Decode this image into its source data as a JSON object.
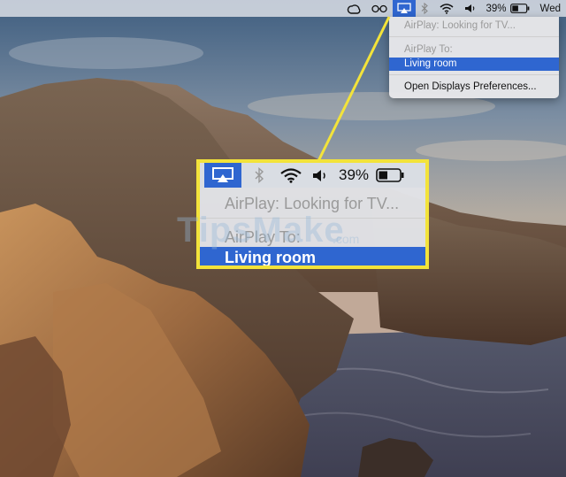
{
  "menubar": {
    "icons": [
      "creative-cloud-icon",
      "glasses-icon",
      "airplay-icon",
      "bluetooth-icon",
      "wifi-icon",
      "volume-icon"
    ],
    "battery_percent": "39%",
    "day": "Wed"
  },
  "airplay_menu": {
    "status": "AirPlay: Looking for TV...",
    "header": "AirPlay To:",
    "selected_device": "Living room",
    "prefs_item": "Open Displays Preferences..."
  },
  "zoom": {
    "battery_percent": "39%",
    "status": "AirPlay: Looking for TV...",
    "header": "AirPlay To:",
    "selected_device": "Living room"
  },
  "watermark": {
    "brand": "TipsMake",
    "suffix": ".com"
  },
  "colors": {
    "accent": "#2f66d0",
    "callout": "#f3e33a"
  }
}
